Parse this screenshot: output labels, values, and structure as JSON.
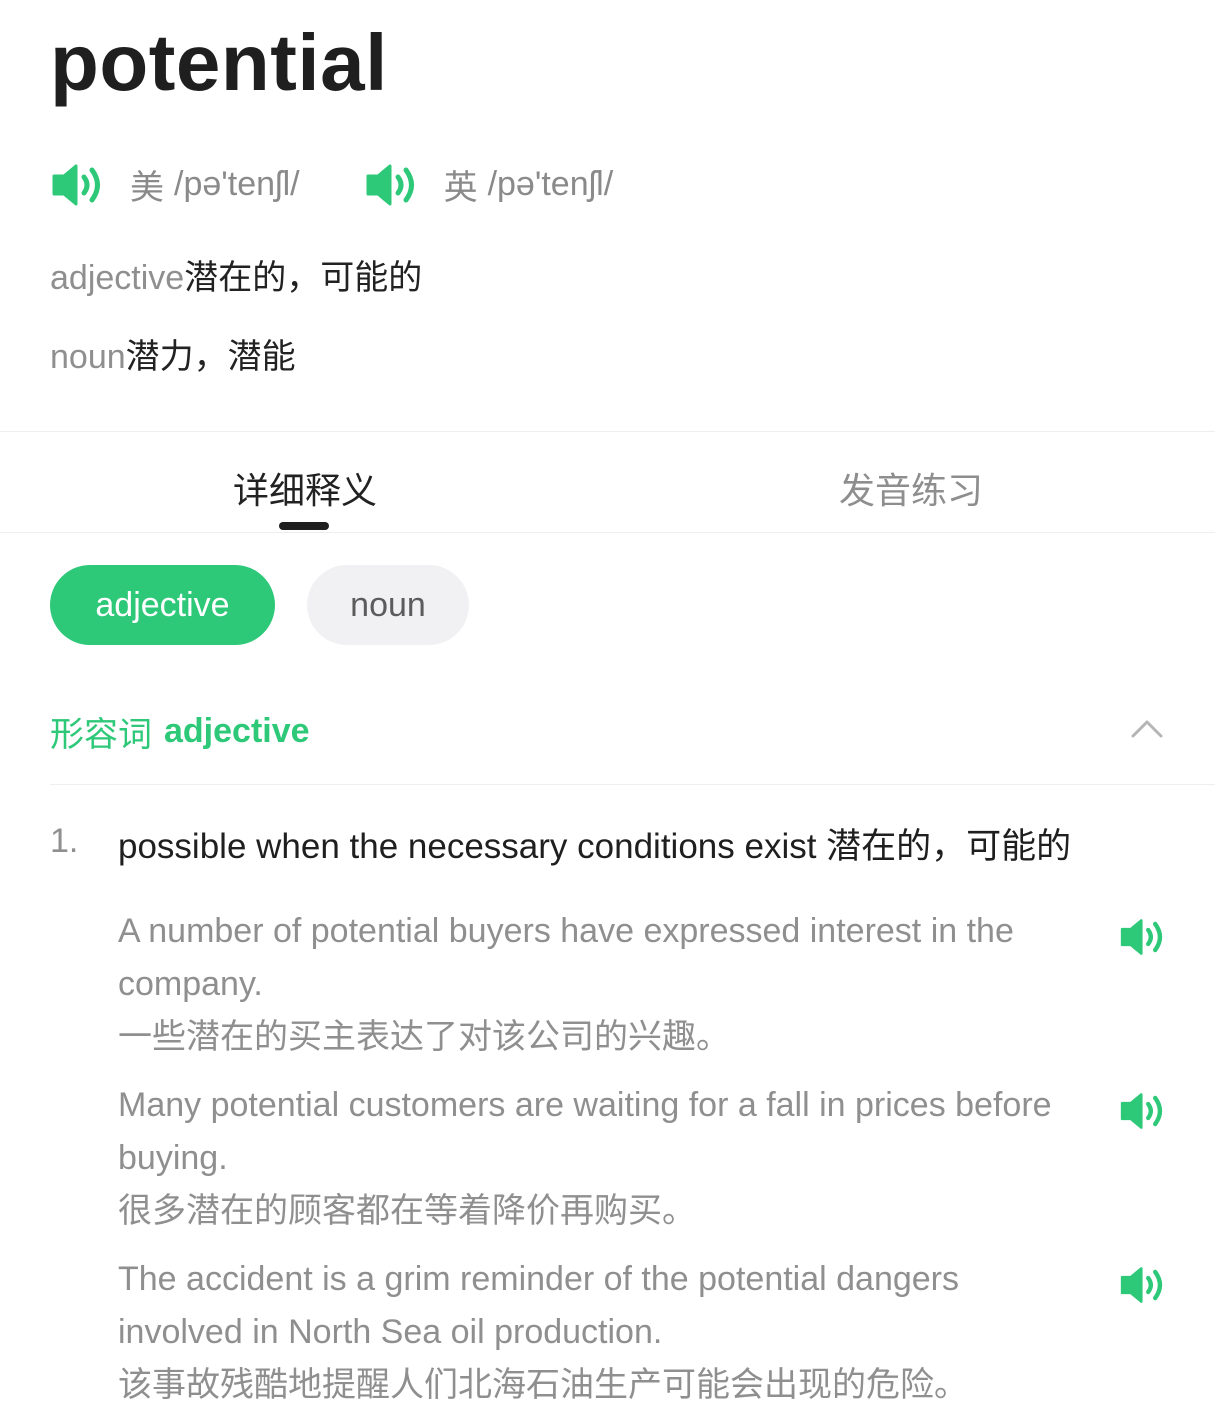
{
  "word": "potential",
  "pronunciations": [
    {
      "accent": "美",
      "ipa": "/pə'tenʃl/",
      "icon": "speaker-icon"
    },
    {
      "accent": "英",
      "ipa": "/pə'tenʃl/",
      "icon": "speaker-icon"
    }
  ],
  "brief_definitions": [
    {
      "pos": "adjective",
      "meaning": "潜在的，可能的"
    },
    {
      "pos": "noun",
      "meaning": "潜力，潜能"
    }
  ],
  "tabs": [
    {
      "label": "详细释义",
      "active": true
    },
    {
      "label": "发音练习",
      "active": false
    }
  ],
  "pos_chips": [
    {
      "label": "adjective",
      "active": true
    },
    {
      "label": "noun",
      "active": false
    }
  ],
  "section": {
    "title_zh": "形容词",
    "title_en": "adjective",
    "collapse_icon": "chevron-up-icon"
  },
  "senses": [
    {
      "number": "1.",
      "definition": "possible when the necessary conditions exist 潜在的，可能的",
      "examples": [
        {
          "en": "A number of potential buyers have expressed interest in the company.",
          "zh": "一些潜在的买主表达了对该公司的兴趣。"
        },
        {
          "en": "Many potential customers are waiting for a fall in prices before buying.",
          "zh": "很多潜在的顾客都在等着降价再购买。"
        },
        {
          "en": "The accident is a grim reminder of the potential dangers involved in North Sea oil production.",
          "zh": "该事故残酷地提醒人们北海石油生产可能会出现的危险。"
        }
      ]
    }
  ],
  "colors": {
    "accent": "#2dc878",
    "text_primary": "#1f1f1f",
    "text_secondary": "#8f8f8f",
    "chip_inactive_bg": "#f1f1f3"
  }
}
